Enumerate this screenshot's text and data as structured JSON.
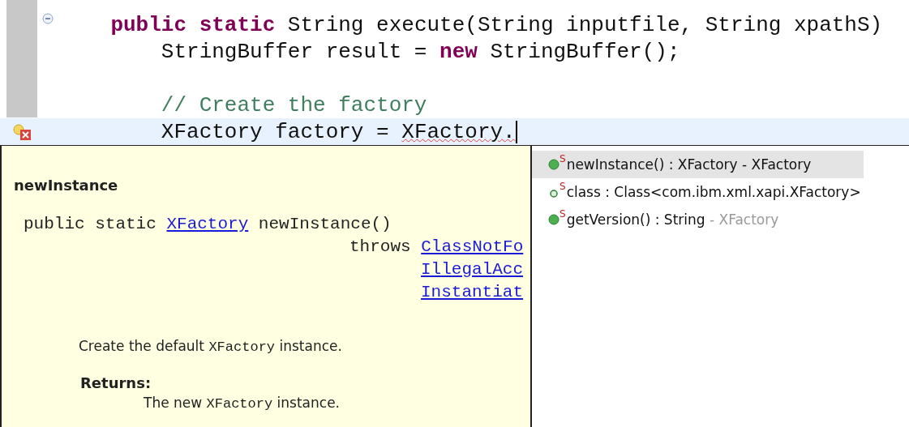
{
  "editor": {
    "lines": [
      {
        "fold_marker": true,
        "error_marker": false,
        "current": false,
        "tokens": [
          {
            "text": "    public static",
            "kind": "keyword"
          },
          {
            "text": " String execute(String inputfile, String xpathS)",
            "kind": "plain"
          }
        ]
      },
      {
        "fold_marker": false,
        "error_marker": false,
        "current": false,
        "tokens": [
          {
            "text": "        StringBuffer result = ",
            "kind": "plain"
          },
          {
            "text": "new",
            "kind": "keyword"
          },
          {
            "text": " StringBuffer();",
            "kind": "plain"
          }
        ]
      },
      {
        "fold_marker": false,
        "error_marker": false,
        "current": false
      },
      {
        "fold_marker": false,
        "error_marker": false,
        "current": false,
        "tokens": [
          {
            "text": "        // Create the factory",
            "kind": "comment"
          }
        ]
      },
      {
        "fold_marker": false,
        "error_marker": true,
        "current": true,
        "tokens": [
          {
            "text": "        XFactory factory = ",
            "kind": "plain"
          },
          {
            "text": "XFactory.",
            "kind": "error"
          }
        ]
      }
    ]
  },
  "javadoc": {
    "title": "newInstance",
    "signature": [
      {
        "kind": "declaration",
        "tokens": [
          {
            "text": "public static ",
            "kind": "plain"
          },
          {
            "text": "XFactory",
            "kind": "link"
          },
          {
            "text": " newInstance()",
            "kind": "plain"
          }
        ]
      },
      {
        "kind": "throws",
        "tokens": [
          {
            "text": "throws ",
            "kind": "plain"
          },
          {
            "text": "ClassNotFo",
            "kind": "link"
          }
        ]
      },
      {
        "kind": "continuation",
        "tokens": [
          {
            "text": "IllegalAcc",
            "kind": "link"
          }
        ]
      },
      {
        "kind": "continuation",
        "tokens": [
          {
            "text": "Instantiat",
            "kind": "link"
          }
        ]
      }
    ],
    "description": [
      {
        "text": "Create the default ",
        "kind": "text"
      },
      {
        "text": "XFactory",
        "kind": "code"
      },
      {
        "text": " instance.",
        "kind": "text"
      }
    ],
    "returns_heading": "Returns:",
    "returns": [
      {
        "text": "The new ",
        "kind": "text"
      },
      {
        "text": "XFactory",
        "kind": "code"
      },
      {
        "text": " instance.",
        "kind": "text"
      }
    ]
  },
  "completions": [
    {
      "kind": "method",
      "modifier": "S",
      "label": "newInstance() : XFactory",
      "qualifier": " - XFactory",
      "selected": true
    },
    {
      "kind": "field",
      "modifier": "S",
      "label": "class : Class<com.ibm.xml.xapi.XFactory>",
      "selected": false
    },
    {
      "kind": "method",
      "modifier": "S",
      "label": "getVersion() : String",
      "qualifier": " - XFactory",
      "selected": false
    }
  ]
}
